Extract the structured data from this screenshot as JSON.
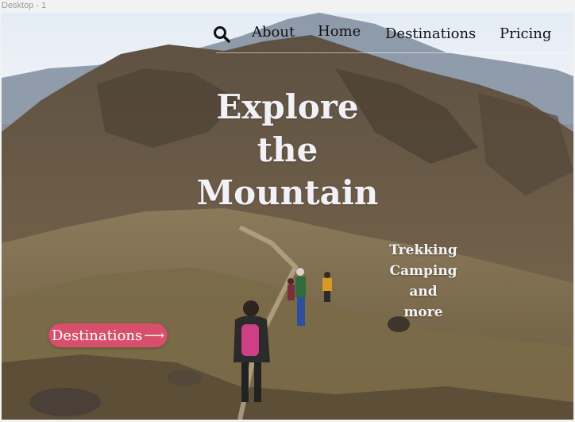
{
  "artboard": {
    "label": "Desktop - 1"
  },
  "nav": {
    "search_icon": "search-icon",
    "links": [
      "About",
      "Home",
      "Destinations",
      "Pricing"
    ]
  },
  "hero": {
    "title_lines": [
      "Explore",
      "the",
      "Mountain"
    ],
    "tagline_lines": [
      "Trekking",
      "Camping",
      "and",
      "more"
    ],
    "cta_label": "Destinations",
    "cta_arrow": "⟶",
    "colors": {
      "cta": "#d84f6c",
      "title": "#f1f1f6",
      "nav_text": "#111111"
    }
  }
}
